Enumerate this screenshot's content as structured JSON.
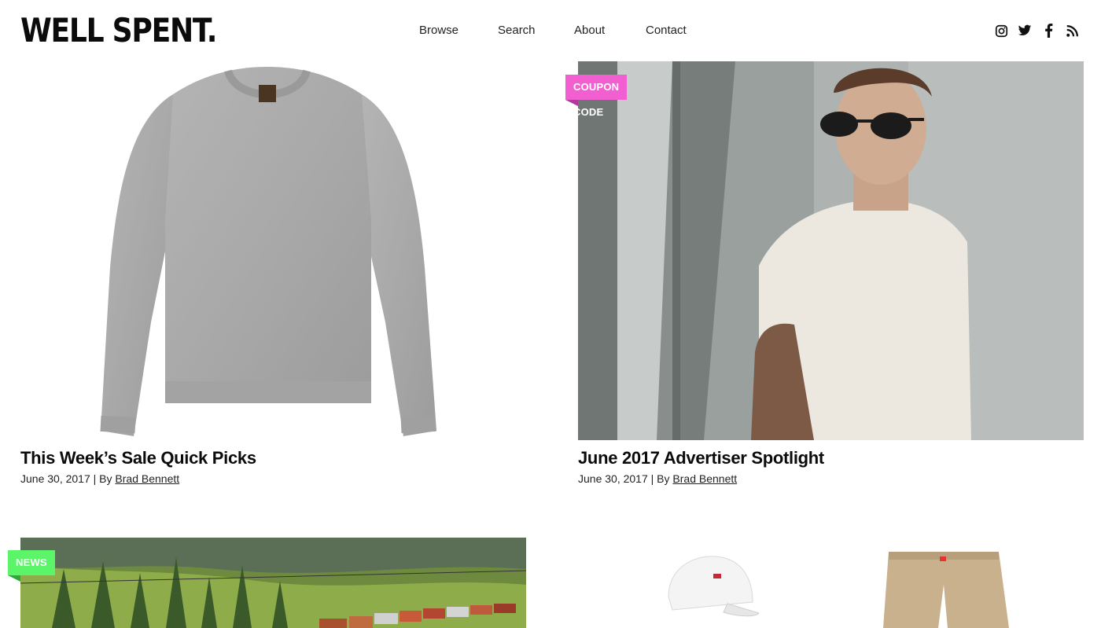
{
  "header": {
    "logo": "WELL SPENT.",
    "nav": [
      {
        "label": "Browse"
      },
      {
        "label": "Search"
      },
      {
        "label": "About"
      },
      {
        "label": "Contact"
      }
    ],
    "social": [
      "instagram-icon",
      "twitter-icon",
      "facebook-icon",
      "rss-icon"
    ]
  },
  "posts": [
    {
      "title": "This Week’s Sale Quick Picks",
      "date": "June 30, 2017",
      "by": "| By",
      "author": "Brad Bennett",
      "image": "grey-sweatshirt"
    },
    {
      "tag": "COUPON CODE",
      "tag_color": "#f25fd0",
      "title": "June 2017 Advertiser Spotlight",
      "date": "June 30, 2017",
      "by": "| By",
      "author": "Brad Bennett",
      "image": "man-in-white-tshirt-sunglasses"
    },
    {
      "tag": "NEWS",
      "tag_color": "#5cf56a",
      "image": "train-through-forest"
    },
    {
      "image": "white-cap-and-khaki-pants"
    }
  ]
}
